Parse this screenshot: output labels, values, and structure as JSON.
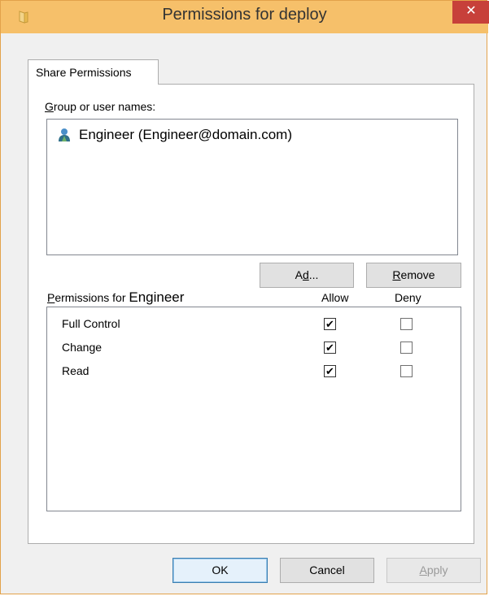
{
  "window": {
    "title": "Permissions for deploy",
    "close_glyph": "✕",
    "title_icon": "shared-folder-icon"
  },
  "tab": {
    "label": "Share Permissions"
  },
  "group_section": {
    "label_underlined": "G",
    "label_rest": "roup or user names:",
    "users": [
      {
        "name": "Engineer (Engineer@domain.com)",
        "icon": "user-icon"
      }
    ],
    "add_button_underlined": "d",
    "add_button_before": "A",
    "add_button_after": "d...",
    "remove_button_underlined": "R",
    "remove_button_rest": "emove"
  },
  "permissions_section": {
    "label_underlined": "P",
    "label_rest": "ermissions for",
    "principal": "Engineer",
    "allow_header": "Allow",
    "deny_header": "Deny",
    "rows": [
      {
        "name": "Full Control",
        "allow": true,
        "deny": false
      },
      {
        "name": "Change",
        "allow": true,
        "deny": false
      },
      {
        "name": "Read",
        "allow": true,
        "deny": false
      }
    ]
  },
  "footer": {
    "ok_label": "OK",
    "cancel_label": "Cancel",
    "apply_underlined": "A",
    "apply_rest": "pply"
  },
  "colors": {
    "titlebar": "#f6c06a",
    "close": "#c7403a"
  }
}
